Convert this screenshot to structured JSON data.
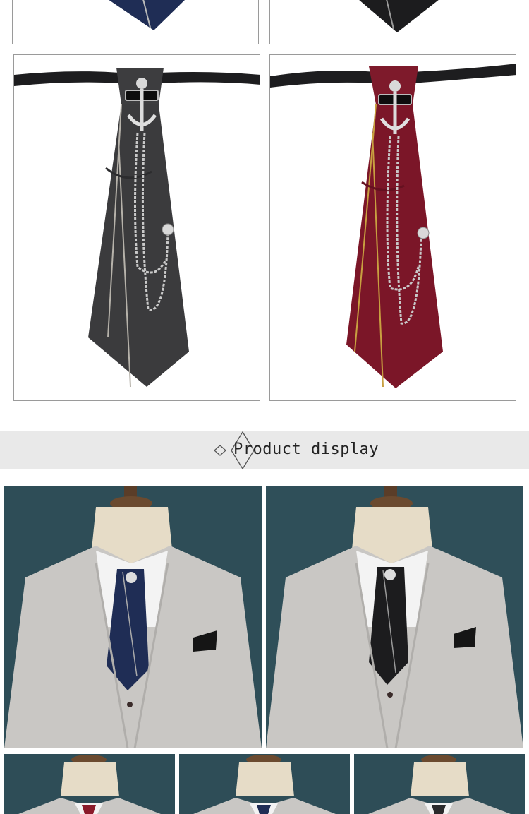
{
  "section_banner": {
    "title": "Product display",
    "icon": "diamond-outline-icon"
  },
  "colors": {
    "banner_bg": "#e9e9e9",
    "tie_navy": "#1f2d55",
    "tie_black": "#1c1c1e",
    "tie_grey": "#3b3b3d",
    "tie_wine": "#7b1628",
    "tie_red": "#8a1a2a",
    "stripe_gold": "#c8a040",
    "suit_grey": "#c9c7c4",
    "backdrop_teal": "#2e4d57"
  },
  "products": [
    {
      "name": "navy-tie-crop",
      "color": "navy"
    },
    {
      "name": "black-tie-crop",
      "color": "black"
    },
    {
      "name": "grey-anchor-tie",
      "color": "grey"
    },
    {
      "name": "wine-anchor-tie",
      "color": "wine"
    }
  ],
  "display_photos": [
    {
      "name": "mannequin-navy-tie",
      "tie_color": "navy"
    },
    {
      "name": "mannequin-black-tie",
      "tie_color": "black"
    },
    {
      "name": "mannequin-red-tie",
      "tie_color": "red"
    },
    {
      "name": "mannequin-navy-tie-small",
      "tie_color": "navy"
    },
    {
      "name": "mannequin-black-tie-small",
      "tie_color": "black"
    }
  ]
}
